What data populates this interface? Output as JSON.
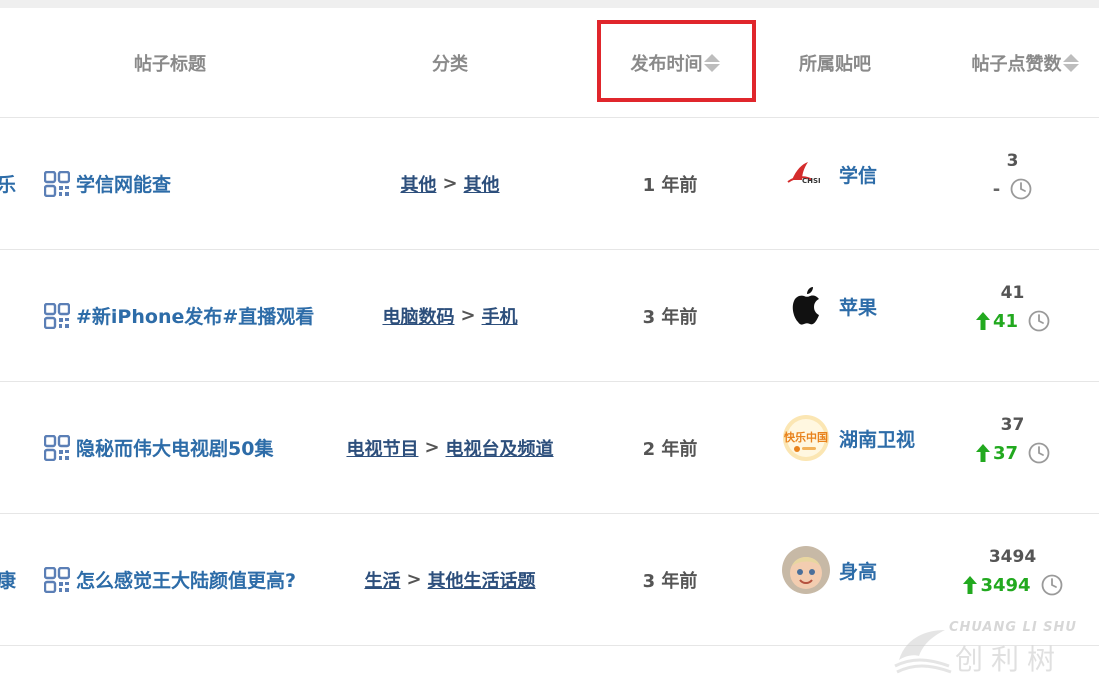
{
  "columns": {
    "title": "帖子标题",
    "category": "分类",
    "publish_time": "发布时间",
    "tieba": "所属贴吧",
    "likes": "帖子点赞数"
  },
  "rows": [
    {
      "prev_text": "乐",
      "title": "学信网能查",
      "cat1": "其他",
      "cat2": "其他",
      "time": "1 年前",
      "bar_name": "学信",
      "bar_logo": "chsi-logo",
      "logo_text": "CHSI",
      "likes": "3",
      "delta": "-",
      "trend": "none"
    },
    {
      "prev_text": "",
      "title": "#新iPhone发布#直播观看",
      "cat1": "电脑数码",
      "cat2": "手机",
      "time": "3 年前",
      "bar_name": "苹果",
      "bar_logo": "apple-logo",
      "likes": "41",
      "delta": "41",
      "trend": "up"
    },
    {
      "prev_text": "",
      "title": "隐秘而伟大电视剧50集",
      "cat1": "电视节目",
      "cat2": "电视台及频道",
      "time": "2 年前",
      "bar_name": "湖南卫视",
      "bar_logo": "hunan-tv-logo",
      "logo_text": "快乐中国",
      "likes": "37",
      "delta": "37",
      "trend": "up"
    },
    {
      "prev_text": "康",
      "title": "怎么感觉王大陆颜值更高?",
      "cat1": "生活",
      "cat2": "其他生活话题",
      "time": "3 年前",
      "bar_name": "身高",
      "bar_logo": "baby-avatar",
      "likes": "3494",
      "delta": "3494",
      "trend": "up"
    }
  ],
  "colors": {
    "link": "#2d6ca8",
    "header_text": "#8a8a8a",
    "highlight_border": "#e0262c",
    "trend_up": "#22a91f"
  },
  "watermark": {
    "en": "CHUANG LI SHU",
    "cn": "创利树"
  }
}
